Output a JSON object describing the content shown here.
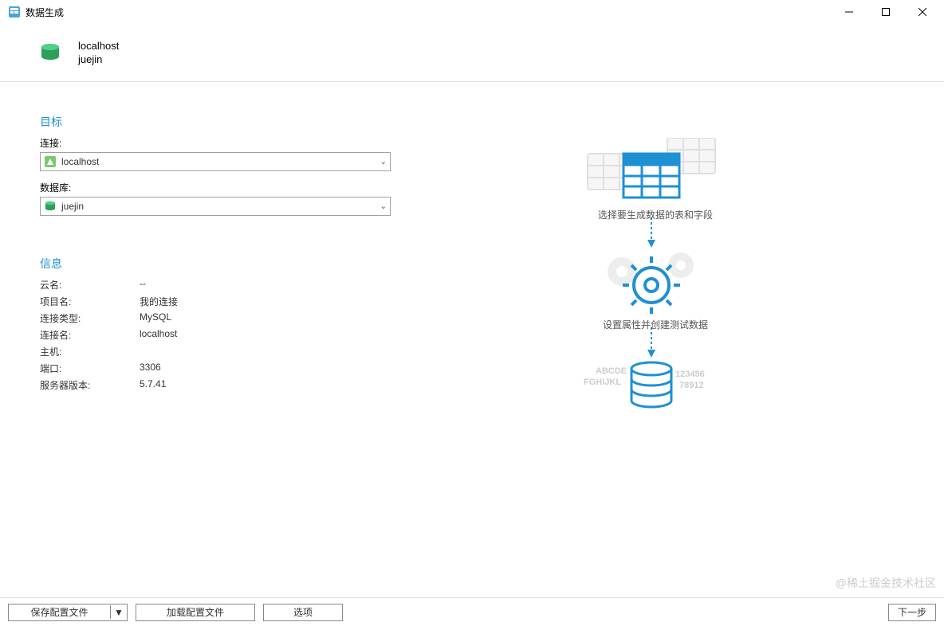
{
  "titlebar": {
    "title": "数据生成"
  },
  "header": {
    "host": "localhost",
    "database": "juejin"
  },
  "target": {
    "section_title": "目标",
    "connection_label": "连接:",
    "connection_value": "localhost",
    "database_label": "数据库:",
    "database_value": "juejin"
  },
  "info": {
    "section_title": "信息",
    "rows": [
      {
        "label": "云名:",
        "value": "--"
      },
      {
        "label": "项目名:",
        "value": "我的连接"
      },
      {
        "label": "连接类型:",
        "value": "MySQL"
      },
      {
        "label": "连接名:",
        "value": "localhost"
      },
      {
        "label": "主机:",
        "value": ""
      },
      {
        "label": "端口:",
        "value": "3306"
      },
      {
        "label": "服务器版本:",
        "value": "5.7.41"
      }
    ]
  },
  "illustration": {
    "step1": "选择要生成数据的表和字段",
    "step2": "设置属性并创建测试数据",
    "bgtext_left1": "ABCDE",
    "bgtext_left2": "FGHIJKL",
    "bgtext_right1": "123456",
    "bgtext_right2": "78912"
  },
  "footer": {
    "save_profile": "保存配置文件",
    "load_profile": "加载配置文件",
    "options": "选项",
    "next": "下一步"
  },
  "watermark": "@稀土掘金技术社区"
}
